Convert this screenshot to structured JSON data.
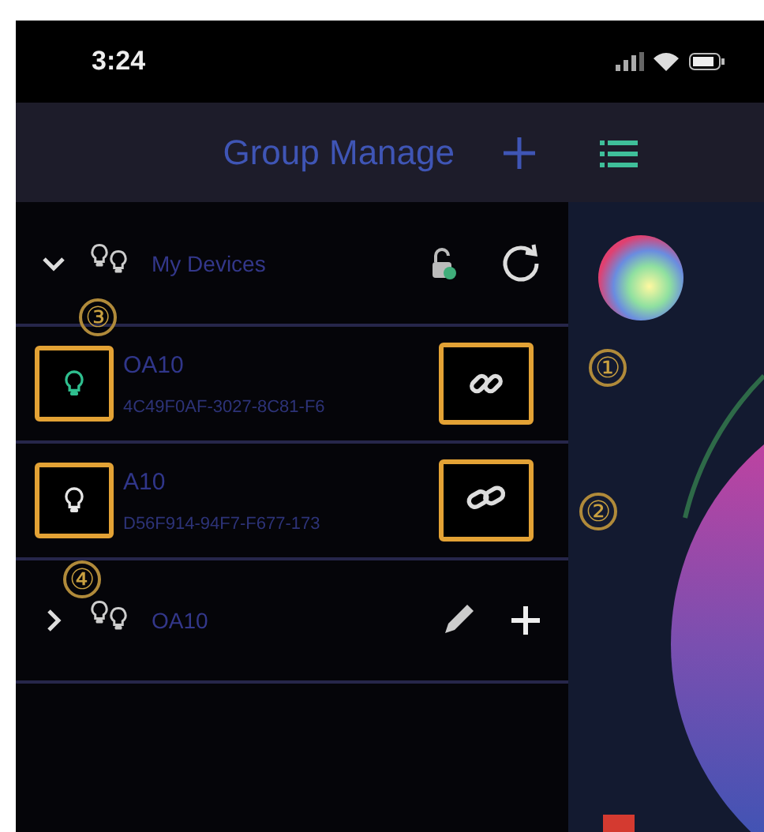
{
  "status_bar": {
    "time": "3:24"
  },
  "nav": {
    "title": "Group Manage"
  },
  "groups": [
    {
      "name": "My Devices",
      "expanded": true,
      "kind": "default",
      "devices": [
        {
          "name": "OA10",
          "id": "4C49F0AF-3027-8C81-F6",
          "on": true,
          "connected": true
        },
        {
          "name": "A10",
          "id": "D56F914-94F7-F677-173",
          "on": false,
          "connected": false
        }
      ]
    },
    {
      "name": "OA10",
      "expanded": false,
      "kind": "custom"
    }
  ],
  "annotations": [
    {
      "label": "①"
    },
    {
      "label": "②"
    },
    {
      "label": "③"
    },
    {
      "label": "④"
    }
  ]
}
